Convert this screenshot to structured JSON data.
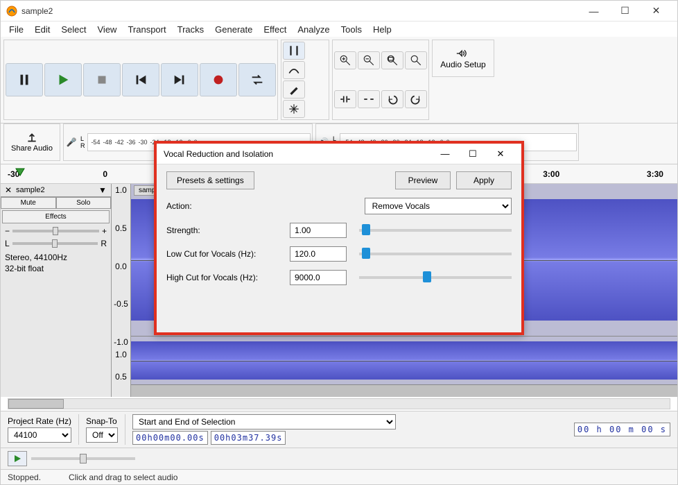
{
  "window": {
    "title": "sample2"
  },
  "window_controls": {
    "min": "—",
    "max": "☐",
    "close": "✕"
  },
  "menu": [
    "File",
    "Edit",
    "Select",
    "View",
    "Transport",
    "Tracks",
    "Generate",
    "Effect",
    "Analyze",
    "Tools",
    "Help"
  ],
  "toolbar": {
    "audio_setup": "Audio Setup",
    "share": "Share Audio"
  },
  "meter_ticks": [
    "-54",
    "-48",
    "-42",
    "-36",
    "-30",
    "-24",
    "-18",
    "-12",
    "-6",
    "0"
  ],
  "timeline": {
    "start_label": "-30",
    "marks": [
      "0",
      "3:00",
      "3:30"
    ]
  },
  "track": {
    "name": "sample2",
    "mute": "Mute",
    "solo": "Solo",
    "effects": "Effects",
    "pan_left": "L",
    "pan_right": "R",
    "gain_minus": "−",
    "gain_plus": "+",
    "info1": "Stereo, 44100Hz",
    "info2": "32-bit float",
    "yscale": [
      "1.0",
      "0.5",
      "0.0",
      "-0.5",
      "-1.0"
    ],
    "yscale2": [
      "1.0",
      "0.5"
    ],
    "wave_label": "samp"
  },
  "dialog": {
    "title": "Vocal Reduction and Isolation",
    "btn_presets": "Presets & settings",
    "btn_preview": "Preview",
    "btn_apply": "Apply",
    "action_label": "Action:",
    "action_value": "Remove Vocals",
    "strength_label": "Strength:",
    "strength_value": "1.00",
    "lowcut_label": "Low Cut for Vocals (Hz):",
    "lowcut_value": "120.0",
    "highcut_label": "High Cut for Vocals (Hz):",
    "highcut_value": "9000.0",
    "min": "—",
    "max": "☐",
    "close": "✕"
  },
  "bottom": {
    "project_rate_label": "Project Rate (Hz)",
    "project_rate_value": "44100",
    "snap_label": "Snap-To",
    "snap_value": "Off",
    "selection_mode": "Start and End of Selection",
    "sel_start": "00h00m00.00s",
    "sel_end": "00h03m37.39s",
    "big_time": "00 h 00 m 00 s"
  },
  "status": {
    "state": "Stopped.",
    "hint": "Click and drag to select audio"
  }
}
